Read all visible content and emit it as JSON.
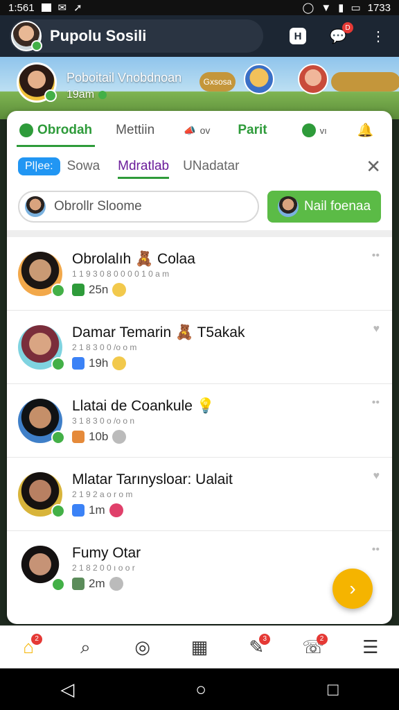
{
  "status_bar": {
    "time_left": "1:561",
    "time_right": "1733"
  },
  "app": {
    "title": "Pupolu Sosili"
  },
  "banner": {
    "name": "Poboitail Vnobdnoan",
    "time": "19am",
    "gold_label": "Gxsosa"
  },
  "tabs": [
    {
      "label": "Obrodah"
    },
    {
      "label": "Mettiin"
    },
    {
      "label": "ov"
    },
    {
      "label": "Parit"
    },
    {
      "label": "vı"
    }
  ],
  "subtabs": {
    "chip": "Pl|ee:",
    "items": [
      "Sowa",
      "Mdratlab",
      "UNadatar"
    ]
  },
  "search": {
    "placeholder": "Obrollr Sloome",
    "button_label": "Nail foenaa"
  },
  "contacts": [
    {
      "name": "Obrolalıh 🧸 Colaa",
      "sub": "1 1 9 3 0 8 0 0 0 0 1 0 a m",
      "meta": "25n",
      "avatar_colors": [
        "#c99a74",
        "#1c1613",
        "#f2a84a"
      ]
    },
    {
      "name": "Damar Temarin 🧸 T5akak",
      "sub": "2 1 8 3 0 0 /o o m",
      "meta": "19h",
      "avatar_colors": [
        "#d9a583",
        "#7a2d3b",
        "#7fd3e0"
      ]
    },
    {
      "name": "Llatai de Coankule 💡",
      "sub": "3 1 8 3 0 o /o o n",
      "meta": "10b",
      "avatar_colors": [
        "#c58f69",
        "#101214",
        "#3f7fc8"
      ]
    },
    {
      "name": "Mlatar Tarınysloar: Ualait",
      "sub": "2 1 9 2 a o r o m",
      "meta": "1m",
      "avatar_colors": [
        "#b88062",
        "#161210",
        "#d8b43a"
      ]
    },
    {
      "name": "Fumy Otar",
      "sub": "2 1 8 2 0 0 ı o o r",
      "meta": "2m",
      "avatar_colors": [
        "#c69376",
        "#141111",
        "#ffffff"
      ]
    }
  ],
  "nav": [
    {
      "icon": "home-icon",
      "badge": "2"
    },
    {
      "icon": "search-icon",
      "badge": ""
    },
    {
      "icon": "chat-search-icon",
      "badge": ""
    },
    {
      "icon": "calendar-icon",
      "badge": ""
    },
    {
      "icon": "edit-icon",
      "badge": "3"
    },
    {
      "icon": "support-icon",
      "badge": "2"
    },
    {
      "icon": "menu-icon",
      "badge": ""
    }
  ],
  "colors": {
    "accent": "#2e9b3a",
    "header": "#1c2633",
    "fab": "#f5b400"
  }
}
